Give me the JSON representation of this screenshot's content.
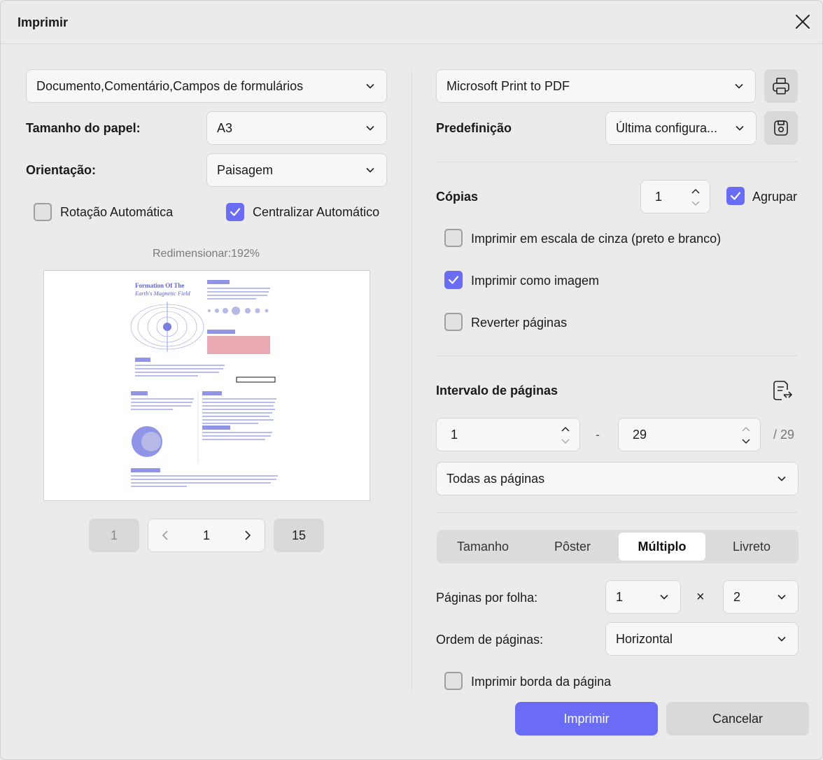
{
  "dialog": {
    "title": "Imprimir"
  },
  "left": {
    "content_select": "Documento,Comentário,Campos de formulários",
    "paper_size": {
      "label": "Tamanho do papel:",
      "value": "A3"
    },
    "orientation": {
      "label": "Orientação:",
      "value": "Paisagem"
    },
    "auto_rotate": {
      "label": "Rotação Automática",
      "checked": false
    },
    "auto_center": {
      "label": "Centralizar Automático",
      "checked": true
    },
    "resize_text": "Redimensionar:192%",
    "preview": {
      "title_line1": "Formation Of The",
      "title_line2": "Earth's Magnetic Field"
    },
    "pager": {
      "first": "1",
      "current": "1",
      "last": "15"
    }
  },
  "right": {
    "printer": "Microsoft Print to PDF",
    "preset": {
      "label": "Predefinição",
      "value": "Última configura..."
    },
    "copies": {
      "label": "Cópias",
      "value": "1"
    },
    "collate": {
      "label": "Agrupar",
      "checked": true
    },
    "grayscale": {
      "label": "Imprimir em escala de cinza (preto e branco)",
      "checked": false
    },
    "as_image": {
      "label": "Imprimir como imagem",
      "checked": true
    },
    "reverse": {
      "label": "Reverter páginas",
      "checked": false
    },
    "range": {
      "label": "Intervalo de páginas",
      "from": "1",
      "separator": "-",
      "to": "29",
      "total": "/ 29",
      "subset": "Todas as páginas"
    },
    "tabs": [
      {
        "label": "Tamanho",
        "active": false
      },
      {
        "label": "Pôster",
        "active": false
      },
      {
        "label": "Múltiplo",
        "active": true
      },
      {
        "label": "Livreto",
        "active": false
      }
    ],
    "pages_per_sheet": {
      "label": "Páginas por folha:",
      "cols": "1",
      "times": "×",
      "rows": "2"
    },
    "page_order": {
      "label": "Ordem de páginas:",
      "value": "Horizontal"
    },
    "print_border": {
      "label": "Imprimir borda da página",
      "checked": false
    }
  },
  "buttons": {
    "print": "Imprimir",
    "cancel": "Cancelar"
  },
  "colors": {
    "accent": "#6b6cf6",
    "preview_blue": "#5b63d6",
    "highlight": "#e8a9b3"
  }
}
